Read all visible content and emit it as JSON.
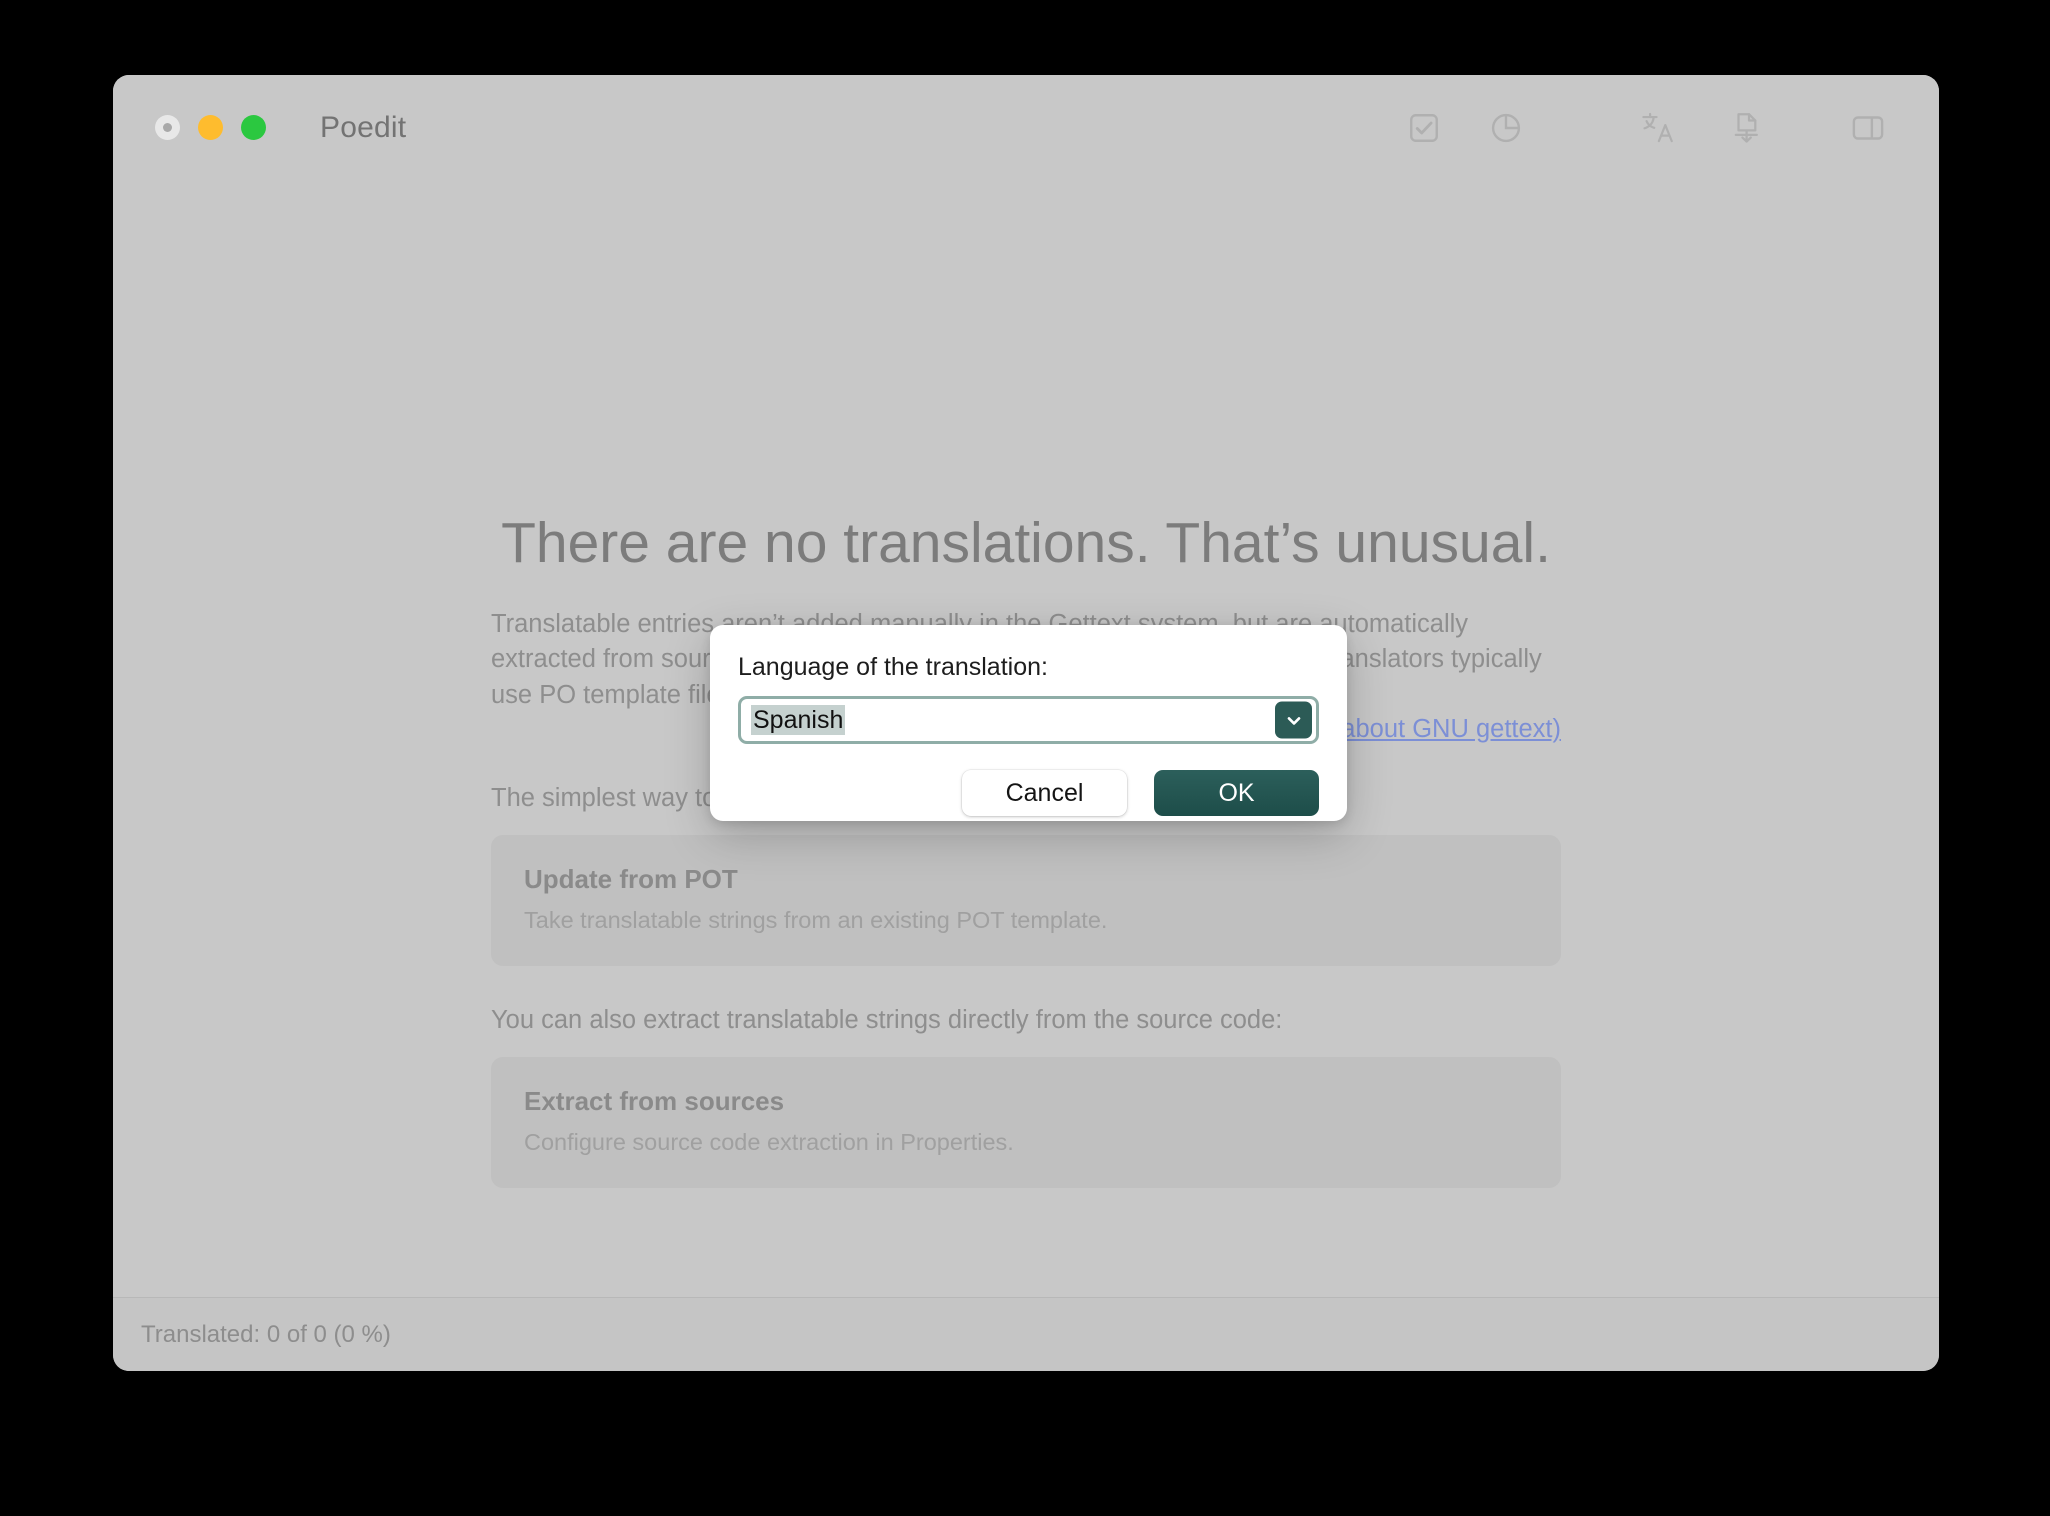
{
  "window": {
    "title": "Poedit",
    "traffic_lights": [
      {
        "name": "close",
        "state": "inactive"
      },
      {
        "name": "minimize",
        "state": "active"
      },
      {
        "name": "maximize",
        "state": "active"
      }
    ],
    "toolbar_icons": [
      "checkmark-box-icon",
      "pie-chart-icon",
      "translate-icon",
      "document-export-icon",
      "sidebar-toggle-icon"
    ]
  },
  "main": {
    "headline": "There are no translations. That’s unusual.",
    "intro": "Translatable entries aren’t added manually in the Gettext system, but are automatically extracted from source code. This way, they stay up to date and accurate. Translators typically use PO template files (POTs) prepared for them by the developer.",
    "gettext_link": "(Learn more about GNU gettext)",
    "lead_pot": "The simplest way to fill this file with translations is to update it from a POT:",
    "cards": [
      {
        "title": "Update from POT",
        "subtitle": "Take translatable strings from an existing POT template."
      },
      {
        "title": "Extract from sources",
        "subtitle": "Configure source code extraction in Properties."
      }
    ],
    "lead_sources": "You can also extract translatable strings directly from the source code:"
  },
  "statusbar": {
    "text": "Translated: 0 of 0 (0 %)"
  },
  "dialog": {
    "label": "Language of the translation:",
    "language_value": "Spanish",
    "language_placeholder": "Language of the translation",
    "dropdown_icon": "chevron-down-icon",
    "cancel_label": "Cancel",
    "ok_label": "OK"
  },
  "colors": {
    "accent": "#215551",
    "focus_ring": "#8fada7",
    "link": "#7c8fd6",
    "window_bg": "#c8c8c8",
    "card_bg": "#c0c0c0",
    "selection": "#c5d1cf"
  }
}
